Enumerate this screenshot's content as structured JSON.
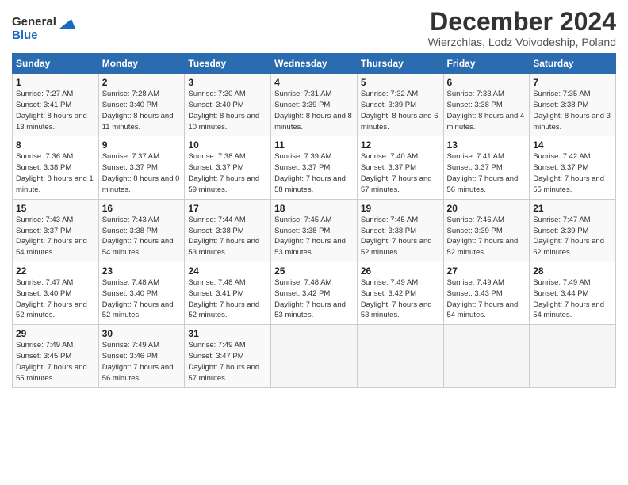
{
  "header": {
    "logo_general": "General",
    "logo_blue": "Blue",
    "title": "December 2024",
    "subtitle": "Wierzchlas, Lodz Voivodeship, Poland"
  },
  "calendar": {
    "days_of_week": [
      "Sunday",
      "Monday",
      "Tuesday",
      "Wednesday",
      "Thursday",
      "Friday",
      "Saturday"
    ],
    "weeks": [
      [
        {
          "day": "1",
          "sunrise": "Sunrise: 7:27 AM",
          "sunset": "Sunset: 3:41 PM",
          "daylight": "Daylight: 8 hours and 13 minutes."
        },
        {
          "day": "2",
          "sunrise": "Sunrise: 7:28 AM",
          "sunset": "Sunset: 3:40 PM",
          "daylight": "Daylight: 8 hours and 11 minutes."
        },
        {
          "day": "3",
          "sunrise": "Sunrise: 7:30 AM",
          "sunset": "Sunset: 3:40 PM",
          "daylight": "Daylight: 8 hours and 10 minutes."
        },
        {
          "day": "4",
          "sunrise": "Sunrise: 7:31 AM",
          "sunset": "Sunset: 3:39 PM",
          "daylight": "Daylight: 8 hours and 8 minutes."
        },
        {
          "day": "5",
          "sunrise": "Sunrise: 7:32 AM",
          "sunset": "Sunset: 3:39 PM",
          "daylight": "Daylight: 8 hours and 6 minutes."
        },
        {
          "day": "6",
          "sunrise": "Sunrise: 7:33 AM",
          "sunset": "Sunset: 3:38 PM",
          "daylight": "Daylight: 8 hours and 4 minutes."
        },
        {
          "day": "7",
          "sunrise": "Sunrise: 7:35 AM",
          "sunset": "Sunset: 3:38 PM",
          "daylight": "Daylight: 8 hours and 3 minutes."
        }
      ],
      [
        {
          "day": "8",
          "sunrise": "Sunrise: 7:36 AM",
          "sunset": "Sunset: 3:38 PM",
          "daylight": "Daylight: 8 hours and 1 minute."
        },
        {
          "day": "9",
          "sunrise": "Sunrise: 7:37 AM",
          "sunset": "Sunset: 3:37 PM",
          "daylight": "Daylight: 8 hours and 0 minutes."
        },
        {
          "day": "10",
          "sunrise": "Sunrise: 7:38 AM",
          "sunset": "Sunset: 3:37 PM",
          "daylight": "Daylight: 7 hours and 59 minutes."
        },
        {
          "day": "11",
          "sunrise": "Sunrise: 7:39 AM",
          "sunset": "Sunset: 3:37 PM",
          "daylight": "Daylight: 7 hours and 58 minutes."
        },
        {
          "day": "12",
          "sunrise": "Sunrise: 7:40 AM",
          "sunset": "Sunset: 3:37 PM",
          "daylight": "Daylight: 7 hours and 57 minutes."
        },
        {
          "day": "13",
          "sunrise": "Sunrise: 7:41 AM",
          "sunset": "Sunset: 3:37 PM",
          "daylight": "Daylight: 7 hours and 56 minutes."
        },
        {
          "day": "14",
          "sunrise": "Sunrise: 7:42 AM",
          "sunset": "Sunset: 3:37 PM",
          "daylight": "Daylight: 7 hours and 55 minutes."
        }
      ],
      [
        {
          "day": "15",
          "sunrise": "Sunrise: 7:43 AM",
          "sunset": "Sunset: 3:37 PM",
          "daylight": "Daylight: 7 hours and 54 minutes."
        },
        {
          "day": "16",
          "sunrise": "Sunrise: 7:43 AM",
          "sunset": "Sunset: 3:38 PM",
          "daylight": "Daylight: 7 hours and 54 minutes."
        },
        {
          "day": "17",
          "sunrise": "Sunrise: 7:44 AM",
          "sunset": "Sunset: 3:38 PM",
          "daylight": "Daylight: 7 hours and 53 minutes."
        },
        {
          "day": "18",
          "sunrise": "Sunrise: 7:45 AM",
          "sunset": "Sunset: 3:38 PM",
          "daylight": "Daylight: 7 hours and 53 minutes."
        },
        {
          "day": "19",
          "sunrise": "Sunrise: 7:45 AM",
          "sunset": "Sunset: 3:38 PM",
          "daylight": "Daylight: 7 hours and 52 minutes."
        },
        {
          "day": "20",
          "sunrise": "Sunrise: 7:46 AM",
          "sunset": "Sunset: 3:39 PM",
          "daylight": "Daylight: 7 hours and 52 minutes."
        },
        {
          "day": "21",
          "sunrise": "Sunrise: 7:47 AM",
          "sunset": "Sunset: 3:39 PM",
          "daylight": "Daylight: 7 hours and 52 minutes."
        }
      ],
      [
        {
          "day": "22",
          "sunrise": "Sunrise: 7:47 AM",
          "sunset": "Sunset: 3:40 PM",
          "daylight": "Daylight: 7 hours and 52 minutes."
        },
        {
          "day": "23",
          "sunrise": "Sunrise: 7:48 AM",
          "sunset": "Sunset: 3:40 PM",
          "daylight": "Daylight: 7 hours and 52 minutes."
        },
        {
          "day": "24",
          "sunrise": "Sunrise: 7:48 AM",
          "sunset": "Sunset: 3:41 PM",
          "daylight": "Daylight: 7 hours and 52 minutes."
        },
        {
          "day": "25",
          "sunrise": "Sunrise: 7:48 AM",
          "sunset": "Sunset: 3:42 PM",
          "daylight": "Daylight: 7 hours and 53 minutes."
        },
        {
          "day": "26",
          "sunrise": "Sunrise: 7:49 AM",
          "sunset": "Sunset: 3:42 PM",
          "daylight": "Daylight: 7 hours and 53 minutes."
        },
        {
          "day": "27",
          "sunrise": "Sunrise: 7:49 AM",
          "sunset": "Sunset: 3:43 PM",
          "daylight": "Daylight: 7 hours and 54 minutes."
        },
        {
          "day": "28",
          "sunrise": "Sunrise: 7:49 AM",
          "sunset": "Sunset: 3:44 PM",
          "daylight": "Daylight: 7 hours and 54 minutes."
        }
      ],
      [
        {
          "day": "29",
          "sunrise": "Sunrise: 7:49 AM",
          "sunset": "Sunset: 3:45 PM",
          "daylight": "Daylight: 7 hours and 55 minutes."
        },
        {
          "day": "30",
          "sunrise": "Sunrise: 7:49 AM",
          "sunset": "Sunset: 3:46 PM",
          "daylight": "Daylight: 7 hours and 56 minutes."
        },
        {
          "day": "31",
          "sunrise": "Sunrise: 7:49 AM",
          "sunset": "Sunset: 3:47 PM",
          "daylight": "Daylight: 7 hours and 57 minutes."
        },
        null,
        null,
        null,
        null
      ]
    ]
  }
}
